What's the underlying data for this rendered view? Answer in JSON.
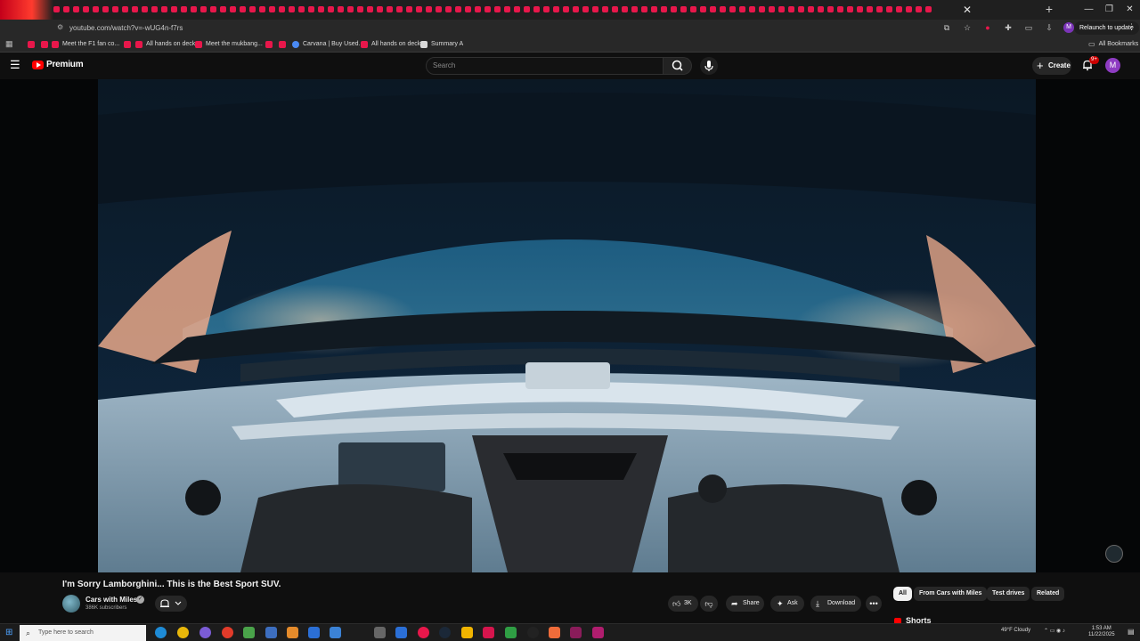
{
  "browser": {
    "url": "youtube.com/watch?v=-wUG4n-f7rs",
    "relaunch_label": "Relaunch to update",
    "all_bookmarks": "All Bookmarks",
    "bookmarks": [
      {
        "label": "Meet the F1 fan co..."
      },
      {
        "label": "All hands on deck"
      },
      {
        "label": "Meet the mukbang..."
      },
      {
        "label": "Carvana | Buy Used..."
      },
      {
        "label": "All hands on deck"
      },
      {
        "label": "Summary A"
      }
    ],
    "profile_initial": "M"
  },
  "youtube": {
    "logo_label": "Premium",
    "search_placeholder": "Search",
    "create_label": "Create",
    "notification_count": "9+",
    "user_initial": "M"
  },
  "video": {
    "title": "I'm Sorry Lamborghini... This is the Best Sport SUV.",
    "channel": "Cars with Miles",
    "subscribers": "386K subscribers",
    "likes": "3K",
    "share_label": "Share",
    "ask_label": "Ask",
    "download_label": "Download"
  },
  "related": {
    "chips": [
      "All",
      "From Cars with Miles",
      "Test drives",
      "Related"
    ],
    "shorts_label": "Shorts"
  },
  "taskbar": {
    "search_placeholder": "Type here to search",
    "weather": "49°F  Cloudy",
    "time": "1:53 AM",
    "date": "11/22/2025"
  },
  "colors": {
    "background": "#0f0f0f",
    "youtube_red": "#ff0000",
    "tab_favicon": "#e8174b"
  }
}
